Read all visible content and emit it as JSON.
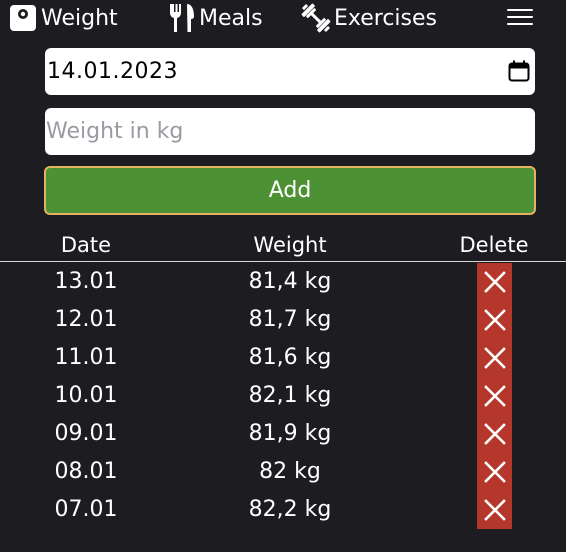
{
  "nav": {
    "items": [
      {
        "label": "Weight",
        "icon": "scale-icon"
      },
      {
        "label": "Meals",
        "icon": "fork-knife-icon"
      },
      {
        "label": "Exercises",
        "icon": "dumbbell-icon"
      }
    ],
    "menu_icon": "hamburger-menu-icon"
  },
  "form": {
    "date_value": "14.01.2023",
    "weight_placeholder": "Weight in kg",
    "weight_value": "",
    "add_label": "Add"
  },
  "table": {
    "headers": {
      "date": "Date",
      "weight": "Weight",
      "delete": "Delete"
    },
    "rows": [
      {
        "date": "13.01",
        "weight": "81,4 kg"
      },
      {
        "date": "12.01",
        "weight": "81,7 kg"
      },
      {
        "date": "11.01",
        "weight": "81,6 kg"
      },
      {
        "date": "10.01",
        "weight": "82,1 kg"
      },
      {
        "date": "09.01",
        "weight": "81,9 kg"
      },
      {
        "date": "08.01",
        "weight": "82 kg"
      },
      {
        "date": "07.01",
        "weight": "82,2 kg"
      }
    ]
  },
  "colors": {
    "background": "#1c1c21",
    "add_button": "#4c9235",
    "add_button_border": "#e3b260",
    "delete_button": "#b5362b"
  }
}
